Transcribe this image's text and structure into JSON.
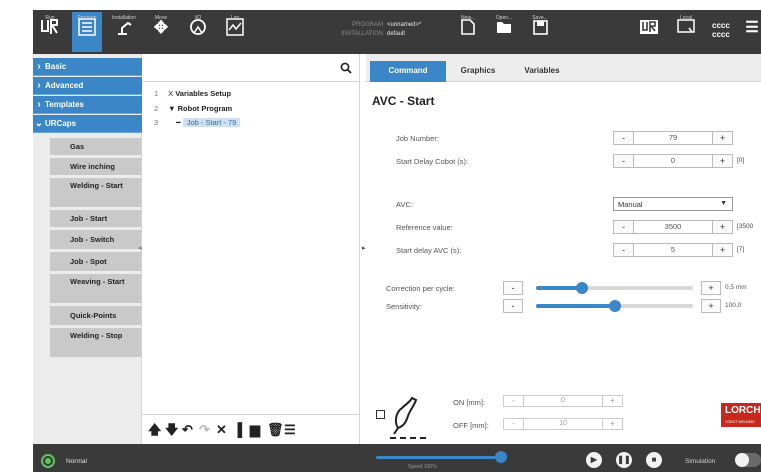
{
  "header": {
    "nav": [
      {
        "label": "Run"
      },
      {
        "label": "Program"
      },
      {
        "label": "Installation"
      },
      {
        "label": "Move"
      },
      {
        "label": "I/O"
      },
      {
        "label": "Log"
      }
    ],
    "program_key": "PROGRAM",
    "program_value": "<unnamed>*",
    "installation_key": "INSTALLATION",
    "installation_value": "default",
    "file_buttons": [
      {
        "label": "New..."
      },
      {
        "label": "Open..."
      },
      {
        "label": "Save..."
      }
    ],
    "local_label": "Local",
    "cccc_line1": "cccc",
    "cccc_line2": "cccc"
  },
  "sidebar": {
    "categories": [
      {
        "label": "Basic"
      },
      {
        "label": "Advanced"
      },
      {
        "label": "Templates"
      },
      {
        "label": "URCaps"
      }
    ],
    "urcaps_items": [
      {
        "label": "Gas"
      },
      {
        "label": "Wire inching"
      },
      {
        "label": "Welding - Start"
      },
      {
        "label": "Job - Start"
      },
      {
        "label": "Job - Switch"
      },
      {
        "label": "Job - Spot"
      },
      {
        "label": "Weaving - Start"
      },
      {
        "label": "Quick-Points"
      },
      {
        "label": "Welding - Stop"
      }
    ]
  },
  "tree": {
    "rows": [
      {
        "num": "1",
        "marker": "X",
        "label": "Variables Setup"
      },
      {
        "num": "2",
        "marker": "▼",
        "label": "Robot Program"
      },
      {
        "num": "3",
        "marker": "━",
        "label": "Job - Start - 79"
      }
    ]
  },
  "tabs": [
    {
      "label": "Command"
    },
    {
      "label": "Graphics"
    },
    {
      "label": "Variables"
    }
  ],
  "command": {
    "title": "AVC - Start",
    "job_number_label": "Job Number:",
    "job_number_value": "79",
    "start_delay_cobot_label": "Start Delay Cobot (s):",
    "start_delay_cobot_value": "0",
    "start_delay_cobot_range": "[0]",
    "avc_label": "AVC:",
    "avc_value": "Manual",
    "reference_label": "Reference value:",
    "reference_value": "3500",
    "reference_range": "[3500",
    "start_delay_avc_label": "Start delay AVC (s):",
    "start_delay_avc_value": "5",
    "start_delay_avc_range": "[7]",
    "correction_label": "Correction per cycle:",
    "correction_value": "0.5 mm",
    "correction_level": 0.29,
    "sensitivity_label": "Sensitivity:",
    "sensitivity_value": "100.0",
    "sensitivity_level": 0.5,
    "on_label": "ON [mm]:",
    "on_value": "0",
    "off_label": "OFF [mm]:",
    "off_value": "10",
    "logo_text": "LORCH",
    "logo_sub": "COBOT WELDING"
  },
  "footer": {
    "status": "Normal",
    "speed_label": "Speed 100%",
    "speed_level": 1.0,
    "simulation_label": "Simulation"
  },
  "colors": {
    "accent": "#3b86c6",
    "header_bg": "#3a3a3a",
    "logo_red": "#c9271b",
    "status_green": "#5ec25e"
  }
}
